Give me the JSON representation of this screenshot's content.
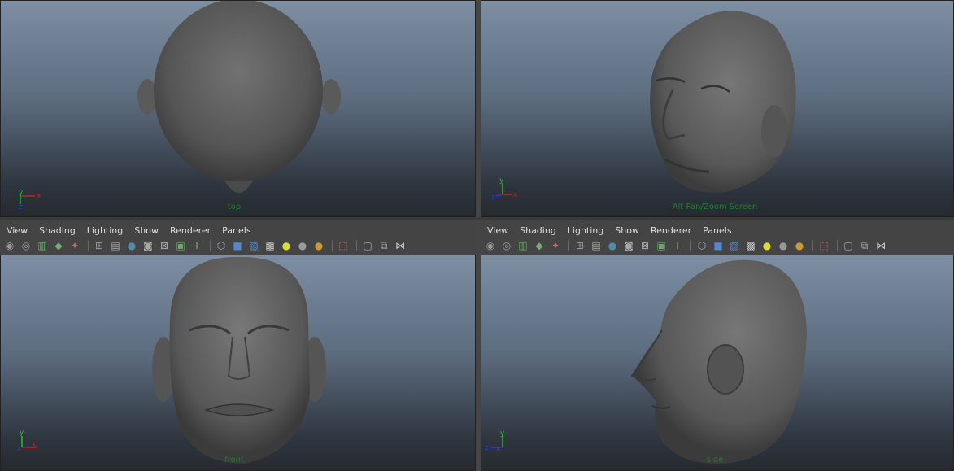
{
  "viewports": {
    "top": {
      "label": "top"
    },
    "persp": {
      "label": "Alt Pan/Zoom Screen"
    },
    "front": {
      "label": "front"
    },
    "side": {
      "label": "side"
    }
  },
  "axes": {
    "x": "x",
    "y": "y",
    "z": "z"
  },
  "menus": [
    "View",
    "Shading",
    "Lighting",
    "Show",
    "Renderer",
    "Panels"
  ],
  "toolbar_icons": [
    "camera-select-icon",
    "camera-attr-icon",
    "bookmark-icon",
    "image-plane-icon",
    "2d-pan-icon",
    "sep",
    "grid-icon",
    "film-gate-icon",
    "resolution-gate-icon",
    "gate-mask-icon",
    "field-chart-icon",
    "safe-action-icon",
    "safe-title-icon",
    "sep",
    "wireframe-icon",
    "smooth-shade-icon",
    "wireframe-on-shaded-icon",
    "textured-icon",
    "default-light-icon",
    "shadows-icon",
    "screen-space-ao-icon",
    "sep",
    "isolate-select-icon",
    "sep",
    "xray-icon",
    "xray-joints-icon",
    "xray-active-icon"
  ],
  "colors": {
    "label_green": "#1d7f2f",
    "axis_red": "#c82020",
    "axis_green": "#22c02a",
    "axis_blue": "#2040d0"
  }
}
